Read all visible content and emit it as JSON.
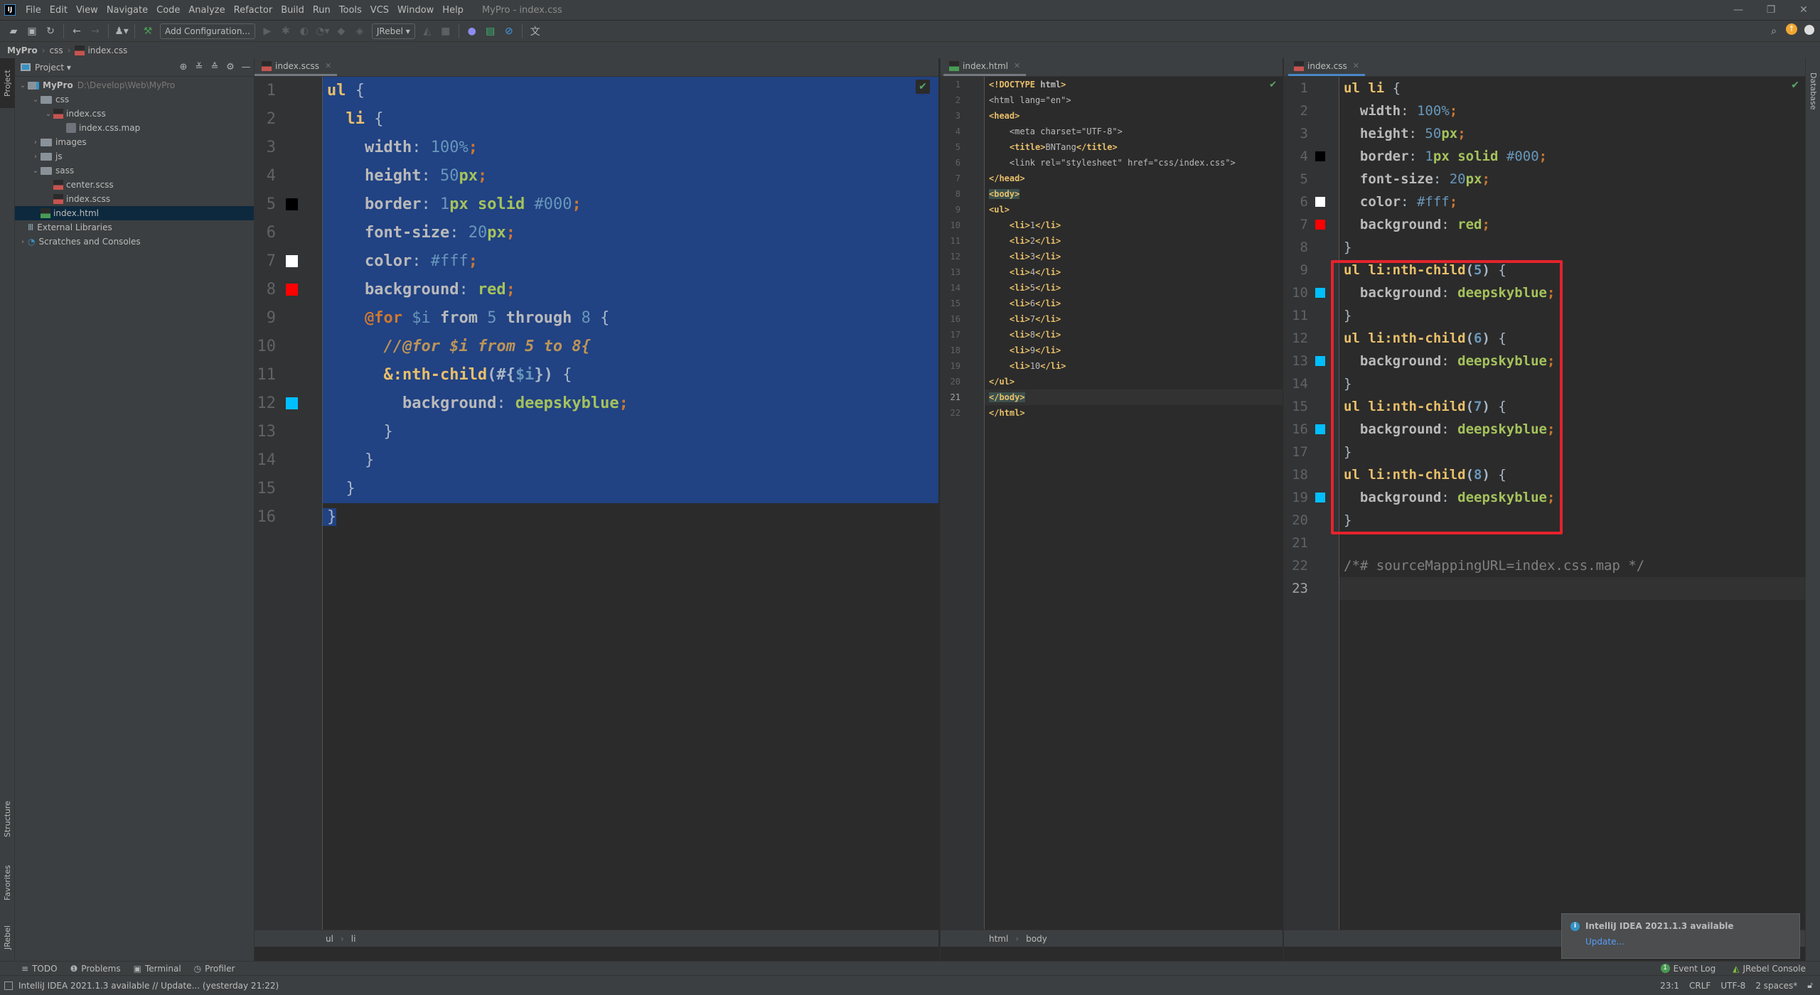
{
  "window": {
    "title": "MyPro - index.css",
    "logo": "IJ",
    "controls": {
      "minimize": "—",
      "restore": "❐",
      "close": "✕"
    }
  },
  "menu": [
    "File",
    "Edit",
    "View",
    "Navigate",
    "Code",
    "Analyze",
    "Refactor",
    "Build",
    "Run",
    "Tools",
    "VCS",
    "Window",
    "Help"
  ],
  "toolbar": {
    "add_configuration": "Add Configuration...",
    "jrebel_select": "JRebel",
    "icons": [
      "open-folder-icon",
      "save-icon",
      "sync-icon",
      "back-arrow-icon",
      "forward-arrow-icon",
      "user-icon",
      "build-hammer-icon",
      "run-icon",
      "debug-icon",
      "coverage-icon",
      "profile-icon",
      "jrebel-run-icon",
      "jrebel-debug-icon",
      "jrebel-rocket-icon",
      "stop-icon",
      "eclipse-icon",
      "monitor-icon",
      "block-icon",
      "translate-icon",
      "search-icon",
      "update-icon",
      "avatar-icon"
    ]
  },
  "breadcrumb": [
    "MyPro",
    "css",
    "index.css"
  ],
  "left_stripe": {
    "project": "Project",
    "structure": "Structure",
    "favorites": "Favorites",
    "jrebel": "JRebel"
  },
  "right_stripe": {
    "database": "Database"
  },
  "project_panel": {
    "title": "Project",
    "tree": [
      {
        "label": "MyPro",
        "hint": "D:\\Develop\\Web\\MyPro",
        "type": "module",
        "depth": 0,
        "expanded": true
      },
      {
        "label": "css",
        "type": "folder",
        "depth": 1,
        "expanded": true
      },
      {
        "label": "index.css",
        "type": "css",
        "depth": 2,
        "expanded": true
      },
      {
        "label": "index.css.map",
        "type": "map",
        "depth": 3
      },
      {
        "label": "images",
        "type": "folder",
        "depth": 1,
        "expanded": false
      },
      {
        "label": "js",
        "type": "folder",
        "depth": 1,
        "expanded": false
      },
      {
        "label": "sass",
        "type": "folder",
        "depth": 1,
        "expanded": true
      },
      {
        "label": "center.scss",
        "type": "sass",
        "depth": 2
      },
      {
        "label": "index.scss",
        "type": "sass",
        "depth": 2
      },
      {
        "label": "index.html",
        "type": "html",
        "depth": 1,
        "selected": true
      },
      {
        "label": "External Libraries",
        "type": "libs",
        "depth": 0
      },
      {
        "label": "Scratches and Consoles",
        "type": "scratch",
        "depth": 0,
        "expanded": false
      }
    ]
  },
  "editors": {
    "scss": {
      "tab": "index.scss",
      "breadcrumb": [
        "ul",
        "li"
      ],
      "swatches": {
        "5": "#000000",
        "7": "#ffffff",
        "8": "#ff0000",
        "12": "#00bfff"
      },
      "lines": [
        "ul {",
        "  li {",
        "    width: 100%;",
        "    height: 50px;",
        "    border: 1px solid #000;",
        "    font-size: 20px;",
        "    color: #fff;",
        "    background: red;",
        "    @for $i from 5 through 8 {",
        "      //@for $i from 5 to 8{",
        "      &:nth-child(#{$i}) {",
        "        background: deepskyblue;",
        "      }",
        "    }",
        "  }",
        "}"
      ]
    },
    "html": {
      "tab": "index.html",
      "breadcrumb": [
        "html",
        "body"
      ],
      "current_line": 21,
      "lines": [
        "<!DOCTYPE html>",
        "<html lang=\"en\">",
        "<head>",
        "    <meta charset=\"UTF-8\">",
        "    <title>BNTang</title>",
        "    <link rel=\"stylesheet\" href=\"css/index.css\">",
        "</head>",
        "<body>",
        "<ul>",
        "    <li>1</li>",
        "    <li>2</li>",
        "    <li>3</li>",
        "    <li>4</li>",
        "    <li>5</li>",
        "    <li>6</li>",
        "    <li>7</li>",
        "    <li>8</li>",
        "    <li>9</li>",
        "    <li>10</li>",
        "</ul>",
        "</body>",
        "</html>"
      ]
    },
    "css": {
      "tab": "index.css",
      "current_line": 23,
      "swatches": {
        "4": "#000000",
        "6": "#ffffff",
        "7": "#ff0000",
        "10": "#00bfff",
        "13": "#00bfff",
        "16": "#00bfff",
        "19": "#00bfff"
      },
      "lines": [
        "ul li {",
        "  width: 100%;",
        "  height: 50px;",
        "  border: 1px solid #000;",
        "  font-size: 20px;",
        "  color: #fff;",
        "  background: red;",
        "}",
        "ul li:nth-child(5) {",
        "  background: deepskyblue;",
        "}",
        "ul li:nth-child(6) {",
        "  background: deepskyblue;",
        "}",
        "ul li:nth-child(7) {",
        "  background: deepskyblue;",
        "}",
        "ul li:nth-child(8) {",
        "  background: deepskyblue;",
        "}",
        "",
        "/*# sourceMappingURL=index.css.map */",
        ""
      ]
    }
  },
  "tool_windows": [
    {
      "icon": "≡",
      "label": "TODO"
    },
    {
      "icon": "❶",
      "label": "Problems"
    },
    {
      "icon": "▣",
      "label": "Terminal"
    },
    {
      "icon": "◷",
      "label": "Profiler"
    }
  ],
  "tool_windows_right": [
    {
      "badge": "1",
      "label": "Event Log"
    },
    {
      "label": "JRebel Console"
    }
  ],
  "status_bar": {
    "message": "IntelliJ IDEA 2021.1.3 available // Update... (yesterday 21:22)",
    "position": "23:1",
    "line_ending": "CRLF",
    "encoding": "UTF-8",
    "indent": "2 spaces*"
  },
  "notification": {
    "title": "IntelliJ IDEA 2021.1.3 available",
    "link": "Update..."
  },
  "colors": {
    "accent": "#4a88c7",
    "selection": "#214283",
    "highlight_box": "#e5232c",
    "swatch_deepskyblue": "#00bfff"
  }
}
